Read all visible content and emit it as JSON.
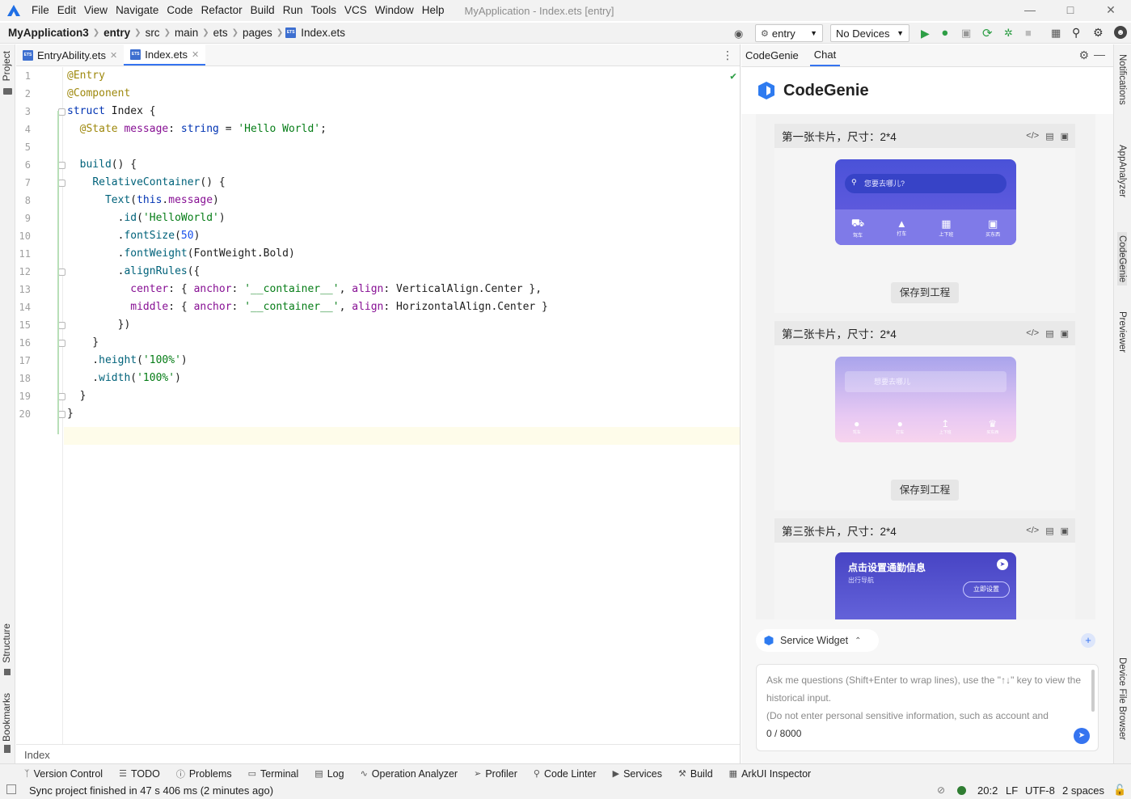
{
  "menu": {
    "items": [
      "File",
      "Edit",
      "View",
      "Navigate",
      "Code",
      "Refactor",
      "Build",
      "Run",
      "Tools",
      "VCS",
      "Window",
      "Help"
    ],
    "title": "MyApplication - Index.ets [entry]"
  },
  "breadcrumb": [
    "MyApplication3",
    "entry",
    "src",
    "main",
    "ets",
    "pages",
    "Index.ets"
  ],
  "run": {
    "module": "entry",
    "device": "No Devices"
  },
  "left_tabs": {
    "project": "Project",
    "structure": "Structure",
    "bookmarks": "Bookmarks"
  },
  "right_tabs": {
    "notifications": "Notifications",
    "appanalyzer": "AppAnalyzer",
    "codegenie": "CodeGenie",
    "previewer": "Previewer",
    "devicefile": "Device File Browser"
  },
  "editor": {
    "tabs": [
      {
        "label": "EntryAbility.ets"
      },
      {
        "label": "Index.ets"
      }
    ],
    "footer": "Index"
  },
  "code_lines": [
    "@Entry",
    "@Component",
    "struct Index {",
    "  @State message: string = 'Hello World';",
    "",
    "  build() {",
    "    RelativeContainer() {",
    "      Text(this.message)",
    "        .id('HelloWorld')",
    "        .fontSize(50)",
    "        .fontWeight(FontWeight.Bold)",
    "        .alignRules({",
    "          center: { anchor: '__container__', align: VerticalAlign.Center },",
    "          middle: { anchor: '__container__', align: HorizontalAlign.Center }",
    "        })",
    "    }",
    "    .height('100%')",
    "    .width('100%')",
    "  }",
    "}"
  ],
  "panel": {
    "tabs": [
      "CodeGenie",
      "Chat"
    ],
    "brand": "CodeGenie",
    "cards": [
      {
        "title": "第一张卡片，尺寸：2*4",
        "save": "保存到工程",
        "search": "您要去哪儿?",
        "icons": [
          "驾车",
          "打车",
          "上下班",
          "买东西"
        ]
      },
      {
        "title": "第二张卡片，尺寸：2*4",
        "save": "保存到工程",
        "search": "想要去哪儿",
        "icons": [
          "驾车",
          "打车",
          "上下班",
          "买东西"
        ]
      },
      {
        "title": "第三张卡片，尺寸：2*4",
        "heading": "点击设置通勤信息",
        "sub": "出行导航",
        "btn": "立即设置"
      }
    ],
    "service_widget": "Service Widget",
    "input_placeholder": "Ask me questions (Shift+Enter to wrap lines), use the \"↑↓\" key to view the historical input.",
    "input_note": "(Do not enter personal sensitive information, such as account and",
    "char_count": "0 / 8000"
  },
  "bottom_tools": [
    "Version Control",
    "TODO",
    "Problems",
    "Terminal",
    "Log",
    "Operation Analyzer",
    "Profiler",
    "Code Linter",
    "Services",
    "Build",
    "ArkUI Inspector"
  ],
  "status": {
    "message": "Sync project finished in 47 s 406 ms (2 minutes ago)",
    "position": "20:2",
    "line_sep": "LF",
    "encoding": "UTF-8",
    "indent": "2 spaces"
  },
  "colors": {
    "accent": "#3574f0",
    "widget1": "#5b5bd6",
    "widget2": "#b9b0f0",
    "widget3": "#4f4cc7"
  }
}
